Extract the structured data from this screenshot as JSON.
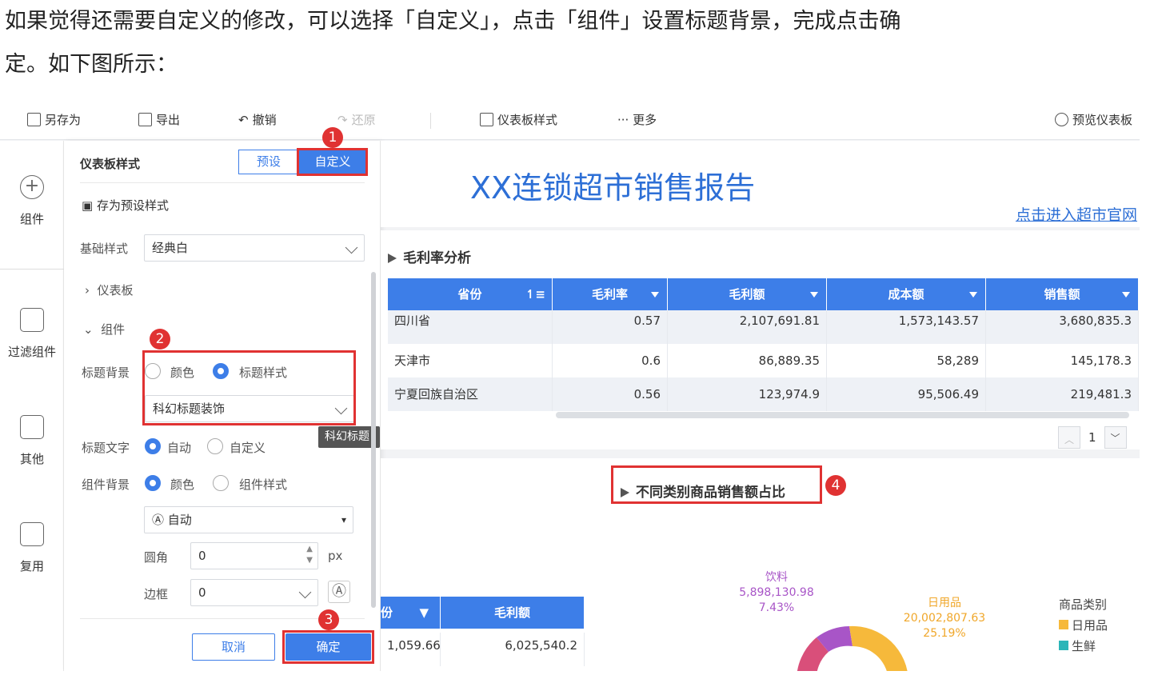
{
  "intro": {
    "line1": "如果觉得还需要自定义的修改，可以选择「自定义」，点击「组件」设置标题背景，完成点击确",
    "line2": "定。如下图所示："
  },
  "toolbar": {
    "save_as": "另存为",
    "export": "导出",
    "undo": "撤销",
    "redo": "还原",
    "style": "仪表板样式",
    "more": "··· 更多",
    "preview": "预览仪表板"
  },
  "sidebar": {
    "components": "组件",
    "filter": "过滤组件",
    "other": "其他",
    "reuse": "复用"
  },
  "panel": {
    "title": "仪表板样式",
    "preset": "预设",
    "custom": "自定义",
    "save_preset": "存为预设样式",
    "base_style_label": "基础样式",
    "base_style_value": "经典白",
    "dashboard_section": "仪表板",
    "component_section": "组件",
    "title_bg_label": "标题背景",
    "opt_color": "颜色",
    "opt_title_style": "标题样式",
    "title_style_value": "科幻标题装饰",
    "tooltip": "科幻标题装饰",
    "title_text_label": "标题文字",
    "opt_auto": "自动",
    "opt_custom": "自定义",
    "comp_bg_label": "组件背景",
    "opt_comp_style": "组件样式",
    "auto_value": "自动",
    "radius_label": "圆角",
    "radius_value": "0",
    "unit_px": "px",
    "border_label": "边框",
    "border_value": "0",
    "cancel": "取消",
    "confirm": "确定"
  },
  "badges": {
    "b1": "1",
    "b2": "2",
    "b3": "3",
    "b4": "4"
  },
  "dashboard": {
    "title": "XX连锁超市销售报告",
    "link": "点击进入超市官网",
    "card1_title": "毛利率分析",
    "headers": [
      "省份",
      "毛利率",
      "毛利额",
      "成本额",
      "销售额"
    ],
    "rows": [
      [
        "四川省",
        "0.57",
        "2,107,691.81",
        "1,573,143.57",
        "3,680,835.3"
      ],
      [
        "天津市",
        "0.6",
        "86,889.35",
        "58,289",
        "145,178.3"
      ],
      [
        "宁夏回族自治区",
        "0.56",
        "123,974.9",
        "95,506.49",
        "219,481.3"
      ]
    ],
    "page": "1",
    "card2_title": "不同类别商品销售额占比",
    "t2_headers": [
      "份",
      "毛利额"
    ],
    "t2_row": [
      "1,059.66",
      "6,025,540.2"
    ],
    "legend_title": "商品类别",
    "legend": [
      {
        "name": "日用品",
        "color": "#f6b93b"
      },
      {
        "name": "生鲜",
        "color": "#2bb5b8"
      }
    ],
    "slice_drink": {
      "name": "饮料",
      "value": "5,898,130.98",
      "pct": "7.43%"
    },
    "slice_daily": {
      "name": "日用品",
      "value": "20,002,807.63",
      "pct": "25.19%"
    }
  }
}
